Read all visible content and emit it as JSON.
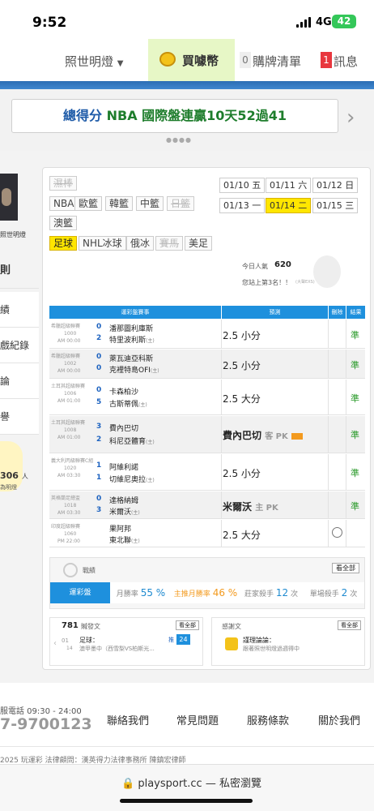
{
  "status": {
    "time": "9:52",
    "network": "4G",
    "battery": "42"
  },
  "topnav": {
    "menu_label": "照世明燈",
    "coin_label": "買噱幣",
    "cart_count": "0",
    "cart_label": "購牌清單",
    "msg_count": "1",
    "msg_label": "訊息"
  },
  "banner": {
    "prefix": "總得分",
    "text": "NBA 國際盤連贏10天52過41"
  },
  "sidebar": {
    "user_name": "照世明燈",
    "items": [
      "則",
      "績",
      "戲紀錄",
      "論",
      "譽"
    ],
    "fans_count": "306",
    "fans_unit": "人",
    "fans_label": "為明燈"
  },
  "sports_tags": [
    "濕棒",
    "NBA",
    "歐籃",
    "韓籃",
    "中籃",
    "日籃",
    "澳籃",
    "足球",
    "NHL冰球",
    "俄冰",
    "賽馬",
    "美足"
  ],
  "dates": [
    "01/10 五",
    "01/11 六",
    "01/12 日",
    "01/13 一",
    "01/14 二",
    "01/15 三"
  ],
  "selected_date": "01/14 二",
  "popularity": {
    "label": "今日人氣",
    "value": "620",
    "rank": "您站上第3名！！",
    "watermark": "(大聲EXS)"
  },
  "table": {
    "headers": [
      "運彩盤賽事",
      "預測",
      "刪除",
      "結果"
    ],
    "rows": [
      {
        "league": "希臘超級聯賽",
        "code": "1000",
        "time": "AM 00:00",
        "n1": "0",
        "t1": "潘那圖利庫斯",
        "n2": "2",
        "t2": "特里波利斯",
        "host": "(主)",
        "pick": "2.5 小分",
        "result": "準"
      },
      {
        "league": "希臘超級聯賽",
        "code": "1002",
        "time": "AM 00:00",
        "n1": "0",
        "t1": "萊瓦迪亞科斯",
        "n2": "0",
        "t2": "克裡特島OFI",
        "host": "(主)",
        "pick": "2.5 小分",
        "result": "準"
      },
      {
        "league": "土耳其超級聯賽",
        "code": "1006",
        "time": "AM 01:00",
        "n1": "0",
        "t1": "卡森柏沙",
        "n2": "5",
        "t2": "古斯蒂佩",
        "host": "(主)",
        "pick": "2.5 大分",
        "result": "準"
      },
      {
        "league": "土耳其超級聯賽",
        "code": "1008",
        "time": "AM 01:00",
        "n1": "3",
        "t1": "費內巴切",
        "n2": "2",
        "t2": "科尼亞體育",
        "host": "(主)",
        "pick": "費內巴切",
        "pick_sub": "客 PK",
        "result": "準"
      },
      {
        "league": "義大利丙級聯賽C組",
        "code": "1020",
        "time": "AM 03:30",
        "n1": "1",
        "t1": "阿維利諾",
        "n2": "1",
        "t2": "切維尼奧拉",
        "host": "(主)",
        "pick": "2.5 小分",
        "result": "準"
      },
      {
        "league": "英格蘭足總盃",
        "code": "1018",
        "time": "AM 03:30",
        "n1": "0",
        "t1": "達格納姆",
        "n2": "3",
        "t2": "米爾沃",
        "host": "(主)",
        "pick": "米爾沃",
        "pick_sub": "主 PK",
        "result": "準"
      },
      {
        "league": "印度超級聯賽",
        "code": "1060",
        "time": "PM 22:00",
        "n1": "",
        "t1": "果阿邦",
        "n2": "",
        "t2": "東北聯",
        "host": "(主)",
        "pick": "2.5 大分",
        "result": ""
      }
    ]
  },
  "record": {
    "title": "戰績",
    "view_all": "看全部",
    "tab": "運彩盤",
    "stats": [
      {
        "label": "月勝率",
        "value": "55 %"
      },
      {
        "label": "主推月勝率",
        "value": "46 %"
      },
      {
        "label": "莊家殺手",
        "value": "12",
        "unit": "次"
      },
      {
        "label": "單場殺手",
        "value": "2",
        "unit": "次"
      }
    ]
  },
  "cards": {
    "left": {
      "count": "781",
      "label": "贓發文",
      "view_all": "看全部",
      "date_top": "01",
      "date_bot": "14",
      "item_title": "足球：",
      "item_desc": "澳甲墨中（西雪梨VS柏斯光...",
      "badge_prefix": "推",
      "badge": "24"
    },
    "right": {
      "label": "感謝文",
      "view_all": "看全部",
      "item_title": "謹理論論：",
      "item_desc": "跟著照世明燈過週得中"
    }
  },
  "footer": {
    "service": "服電話 09:30 - 24:00",
    "phone": "7-9700123",
    "links": [
      "聯絡我們",
      "常見問題",
      "服務條款",
      "關於我們"
    ],
    "copyright": "2025 玩運彩 法律顧問：漢英得力法律事務所 陳鎮宏律師"
  },
  "url": "playsport.cc — 私密瀏覽"
}
